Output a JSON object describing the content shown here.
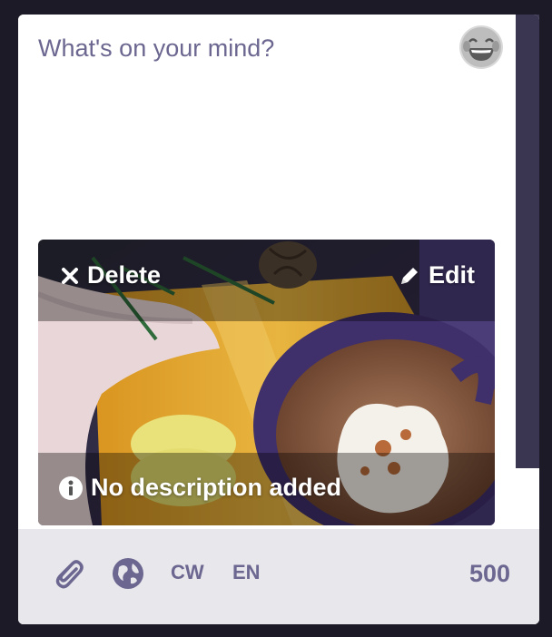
{
  "composer": {
    "placeholder": "What's on your mind?",
    "emoji_icon": "laughing-face-icon"
  },
  "media": {
    "delete_label": "Delete",
    "edit_label": "Edit",
    "description_label": "No description added"
  },
  "toolbar": {
    "attach_icon": "paperclip-icon",
    "visibility_icon": "globe-icon",
    "cw_label": "CW",
    "language_label": "EN",
    "char_counter": "500"
  },
  "colors": {
    "accent": "#6b6790",
    "toolbar_bg": "#e8e7ec",
    "page_bg": "#1b1a26"
  }
}
